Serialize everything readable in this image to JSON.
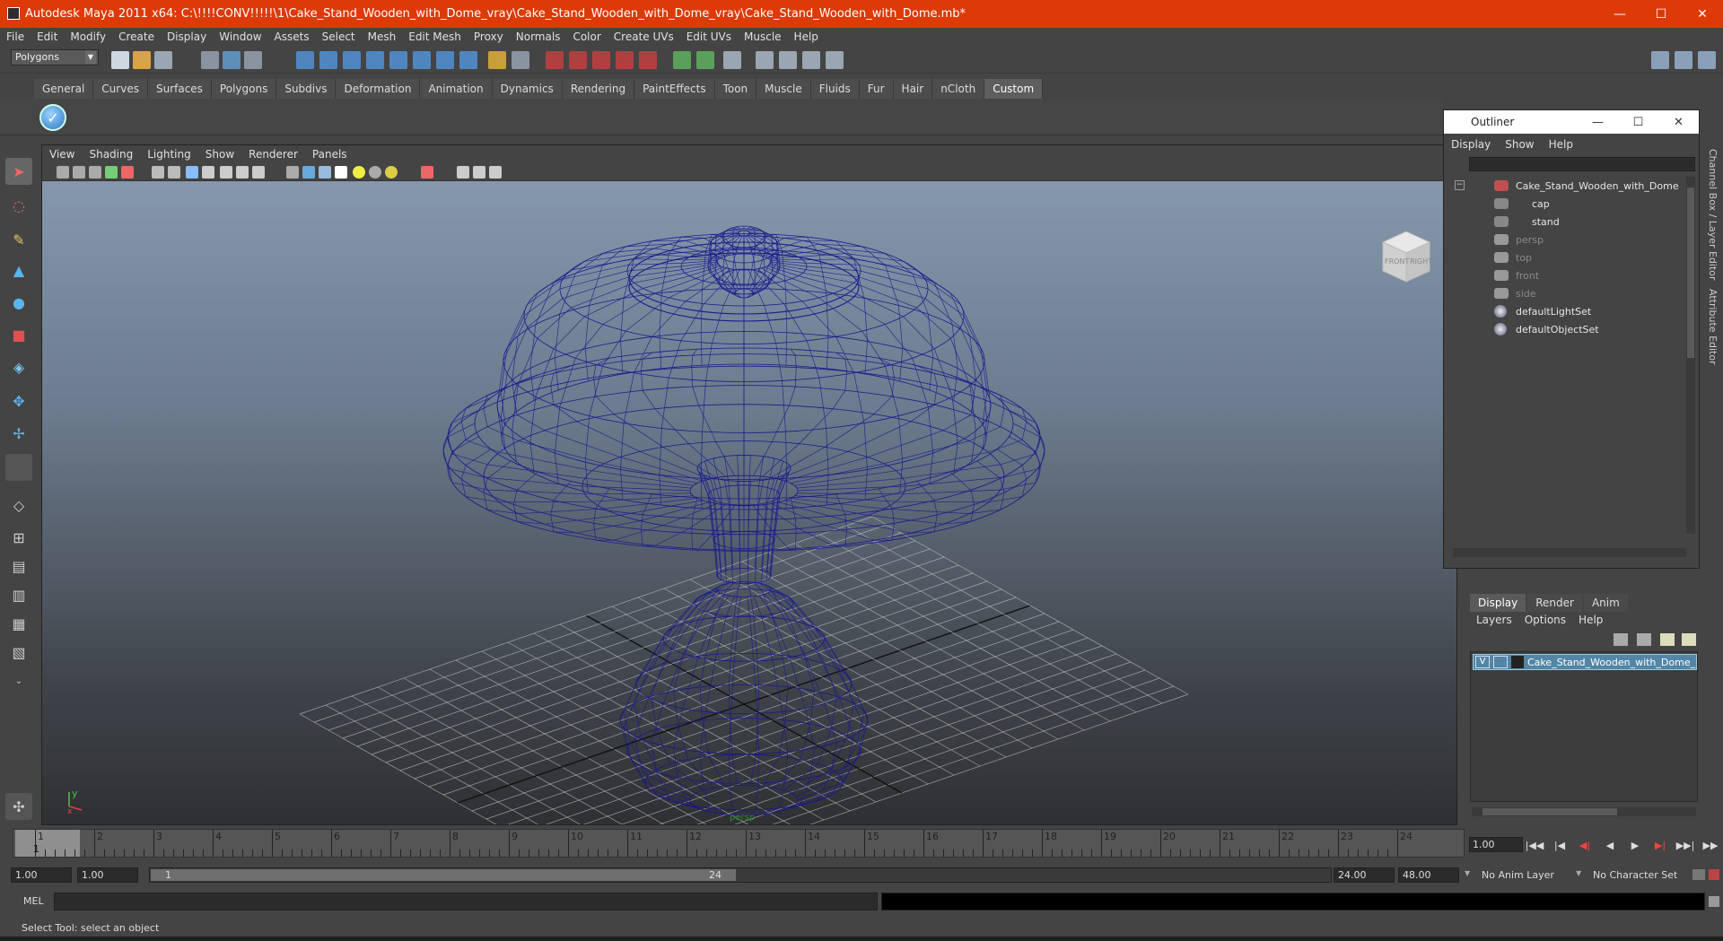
{
  "window": {
    "title": "Autodesk Maya 2011 x64: C:\\!!!!CONV!!!!!\\1\\Cake_Stand_Wooden_with_Dome_vray\\Cake_Stand_Wooden_with_Dome_vray\\Cake_Stand_Wooden_with_Dome.mb*",
    "minimize": "—",
    "maximize": "☐",
    "close": "✕"
  },
  "menubar": [
    "File",
    "Edit",
    "Modify",
    "Create",
    "Display",
    "Window",
    "Assets",
    "Select",
    "Mesh",
    "Edit Mesh",
    "Proxy",
    "Normals",
    "Color",
    "Create UVs",
    "Edit UVs",
    "Muscle",
    "Help"
  ],
  "status_line": {
    "mode": "Polygons"
  },
  "shelf": {
    "tabs": [
      "General",
      "Curves",
      "Surfaces",
      "Polygons",
      "Subdivs",
      "Deformation",
      "Animation",
      "Dynamics",
      "Rendering",
      "PaintEffects",
      "Toon",
      "Muscle",
      "Fluids",
      "Fur",
      "Hair",
      "nCloth",
      "Custom"
    ],
    "active": "Custom"
  },
  "viewport": {
    "menu": [
      "View",
      "Shading",
      "Lighting",
      "Show",
      "Renderer",
      "Panels"
    ],
    "viewcube_front": "FRONT",
    "viewcube_right": "RIGHT",
    "axis_y": "y",
    "axis_x": "x",
    "camera": "persp",
    "wire_color": "#1a1a8c"
  },
  "outliner": {
    "title": "Outliner",
    "menu": [
      "Display",
      "Show",
      "Help"
    ],
    "items": [
      {
        "label": "Cake_Stand_Wooden_with_Dome",
        "dim": false
      },
      {
        "label": "cap",
        "dim": false
      },
      {
        "label": "stand",
        "dim": false
      },
      {
        "label": "persp",
        "dim": true
      },
      {
        "label": "top",
        "dim": true
      },
      {
        "label": "front",
        "dim": true
      },
      {
        "label": "side",
        "dim": true
      },
      {
        "label": "defaultLightSet",
        "dim": false
      },
      {
        "label": "defaultObjectSet",
        "dim": false
      }
    ]
  },
  "side_tabs": [
    "Channel Box / Layer Editor",
    "Attribute Editor"
  ],
  "layer_editor": {
    "tabs": [
      "Display",
      "Render",
      "Anim"
    ],
    "active": "Display",
    "menu": [
      "Layers",
      "Options",
      "Help"
    ],
    "layer": {
      "visible": "V",
      "name": "Cake_Stand_Wooden_with_Dome_layer"
    }
  },
  "timeline": {
    "ticks": [
      "1",
      "2",
      "3",
      "4",
      "5",
      "6",
      "7",
      "8",
      "9",
      "10",
      "11",
      "12",
      "13",
      "14",
      "15",
      "16",
      "17",
      "18",
      "19",
      "20",
      "21",
      "22",
      "23",
      "24"
    ],
    "current_frame": "1",
    "current_field": "1.00",
    "play_controls": [
      "|◀◀",
      "|◀",
      "◀|",
      "◀",
      "▶",
      "▶|",
      "▶▶|",
      "▶▶"
    ]
  },
  "range": {
    "start": "1.00",
    "anim_start": "1.00",
    "slider_start": "1",
    "slider_end": "24",
    "playback_end": "24.00",
    "anim_end": "48.00",
    "anim_layer": "No Anim Layer",
    "char_set": "No Character Set"
  },
  "command_line": {
    "label": "MEL"
  },
  "status": {
    "message": "Select Tool: select an object"
  }
}
